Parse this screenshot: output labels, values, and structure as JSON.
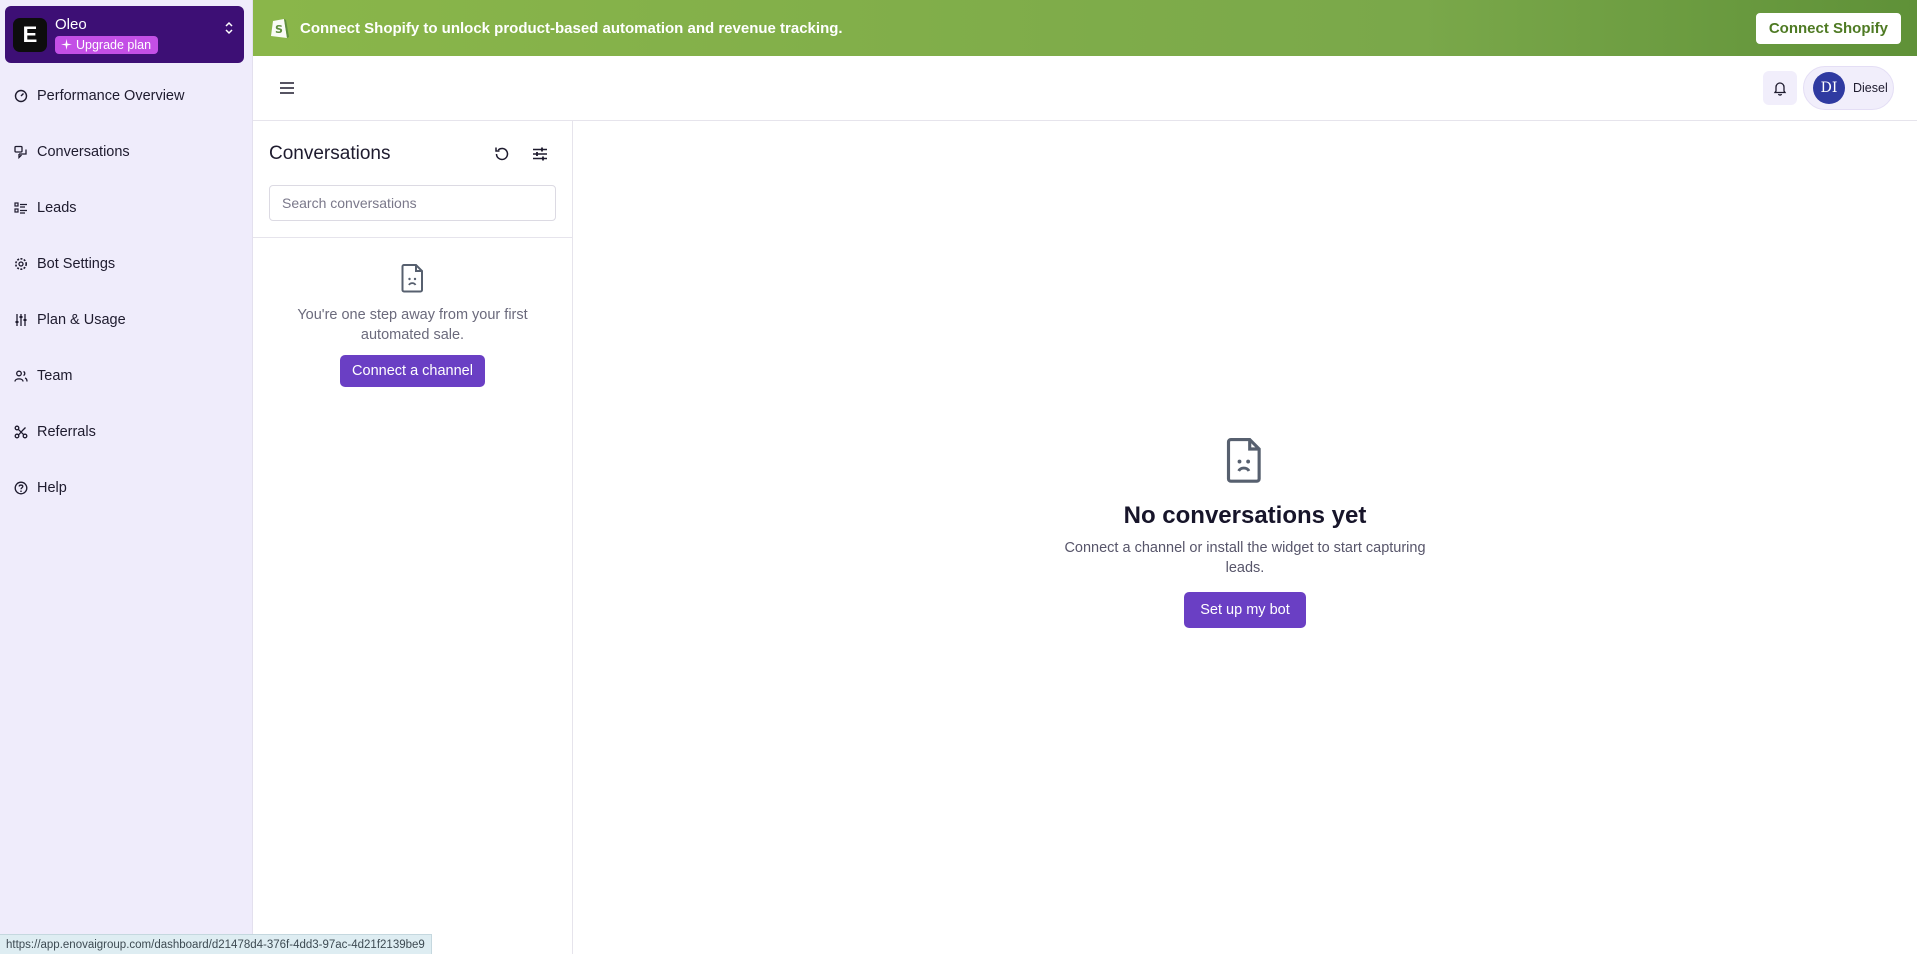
{
  "workspace": {
    "logo_letter": "E",
    "name": "Oleo",
    "upgrade_label": "Upgrade plan"
  },
  "sidebar": {
    "items": [
      {
        "label": "Performance Overview",
        "icon": "gauge-icon"
      },
      {
        "label": "Conversations",
        "icon": "chat-bubbles-icon"
      },
      {
        "label": "Leads",
        "icon": "list-icon"
      },
      {
        "label": "Bot Settings",
        "icon": "gear-icon"
      },
      {
        "label": "Plan & Usage",
        "icon": "sliders-icon"
      },
      {
        "label": "Team",
        "icon": "users-icon"
      },
      {
        "label": "Referrals",
        "icon": "share-icon"
      },
      {
        "label": "Help",
        "icon": "help-circle-icon"
      }
    ]
  },
  "banner": {
    "text": "Connect Shopify to unlock product-based automation and revenue tracking.",
    "button_label": "Connect Shopify",
    "icon": "shopify-icon"
  },
  "topbar": {
    "user_initials": "DI",
    "user_name": "Diesel"
  },
  "conversations_panel": {
    "title": "Conversations",
    "search_placeholder": "Search conversations",
    "empty_text": "You're one step away from your first automated sale.",
    "empty_button": "Connect a channel"
  },
  "main": {
    "empty_title": "No conversations yet",
    "empty_description": "Connect a channel or install the widget to start capturing leads.",
    "empty_button": "Set up my bot"
  },
  "status_bar": {
    "url": "https://app.enovaigroup.com/dashboard/d21478d4-376f-4dd3-97ac-4d21f2139be9"
  },
  "colors": {
    "sidebar_bg": "#efecfb",
    "workspace_bg": "#3d0f75",
    "upgrade_bg": "#c34fe6",
    "primary": "#6a3fc4",
    "banner_green": "#7aa84a",
    "avatar_bg": "#2f3aa1"
  }
}
